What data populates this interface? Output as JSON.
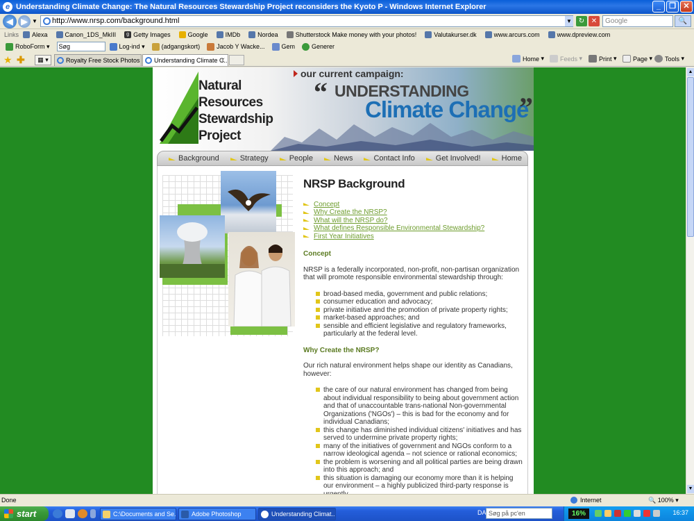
{
  "window": {
    "title": "Understanding Climate Change: The Natural Resources Stewardship Project reconsiders the Kyoto P - Windows Internet Explorer",
    "controls": [
      "_",
      "❐",
      "✕"
    ]
  },
  "address": {
    "url": "http://www.nrsp.com/background.html",
    "search_placeholder": "Google"
  },
  "links_bar": {
    "label": "Links",
    "items": [
      "Alexa",
      "Canon_1DS_MkIII",
      "Getty Images",
      "Google",
      "IMDb",
      "Nordea",
      "Shutterstock Make money with your photos!",
      "Valutakurser.dk",
      "www.arcurs.com",
      "www.dpreview.com"
    ]
  },
  "roboform_bar": {
    "roboform": "RoboForm",
    "search_value": "Søg",
    "login": "Log-ind",
    "passcards": "(adgangskort)",
    "identity": "Jacob Y Wacke...",
    "save": "Gem",
    "generate": "Generer"
  },
  "tabs": {
    "items": [
      {
        "label": "Royalty Free Stock Photos a...",
        "active": false
      },
      {
        "label": "Understanding Climate C...",
        "active": true
      }
    ],
    "close_glyph": "X"
  },
  "command_bar": {
    "home": "Home",
    "feeds": "Feeds",
    "print": "Print",
    "page": "Page",
    "tools": "Tools"
  },
  "site": {
    "logo_lines": [
      "Natural",
      "Resources",
      "Stewardship",
      "Project"
    ],
    "campaign_label": "our current campaign:",
    "campaign_title_1": "UNDERSTANDING",
    "campaign_title_2": "Climate Change",
    "quote_open": "“",
    "quote_close": "”",
    "nav": [
      "Background",
      "Strategy",
      "People",
      "News",
      "Contact Info",
      "Get Involved!",
      "Home"
    ]
  },
  "article": {
    "title": "NRSP Background",
    "toc": [
      "Concept",
      "Why Create the NRSP?",
      "What will the NRSP do?",
      "What defines Responsible Environmental Stewardship?",
      "First Year Initiatives"
    ],
    "concept_heading": "Concept",
    "concept_para": "NRSP is a federally incorporated, non-profit, non-partisan organization that will promote responsible environmental stewardship through:",
    "concept_list": [
      "broad-based media, government and public relations;",
      "consumer education and advocacy;",
      "private initiative and the promotion of private property rights;",
      "market-based approaches; and",
      "sensible and efficient legislative and regulatory frameworks, particularly at the federal level."
    ],
    "why_heading": "Why Create the NRSP?",
    "why_para": "Our rich natural environment helps shape our identity as Canadians, however:",
    "why_list": [
      "the care of our natural environment has changed from being about individual responsibility to being about government action and that of unaccountable trans-national Non-governmental Organizations ('NGOs') – this is bad for the economy and for individual Canadians;",
      "this change has diminished individual citizens' initiatives and has served to undermine private property rights;",
      "many of the initiatives of government and NGOs conform to a narrow ideological agenda – not science or rational economics;",
      "the problem is worsening and all political parties are being drawn into this approach; and",
      "this situation is damaging our economy more than it is helping our environment – a highly publicized third-party response is urgently"
    ]
  },
  "status": {
    "text": "Done",
    "zone": "Internet",
    "zoom": "100%"
  },
  "taskbar": {
    "start": "start",
    "tasks": [
      {
        "label": "C:\\Documents and Se...",
        "active": false
      },
      {
        "label": "Adobe Photoshop",
        "active": false
      },
      {
        "label": "Understanding Climat...",
        "active": true
      }
    ],
    "lang": "DA",
    "search_placeholder": "Søg på pc'en",
    "cpu": "16%",
    "clock": "16:37"
  },
  "colors": {
    "page_background": "#228b22",
    "accent_green": "#6d9c2c",
    "bullet_yellow": "#e1c61a",
    "campaign_blue": "#1d6fb5"
  }
}
